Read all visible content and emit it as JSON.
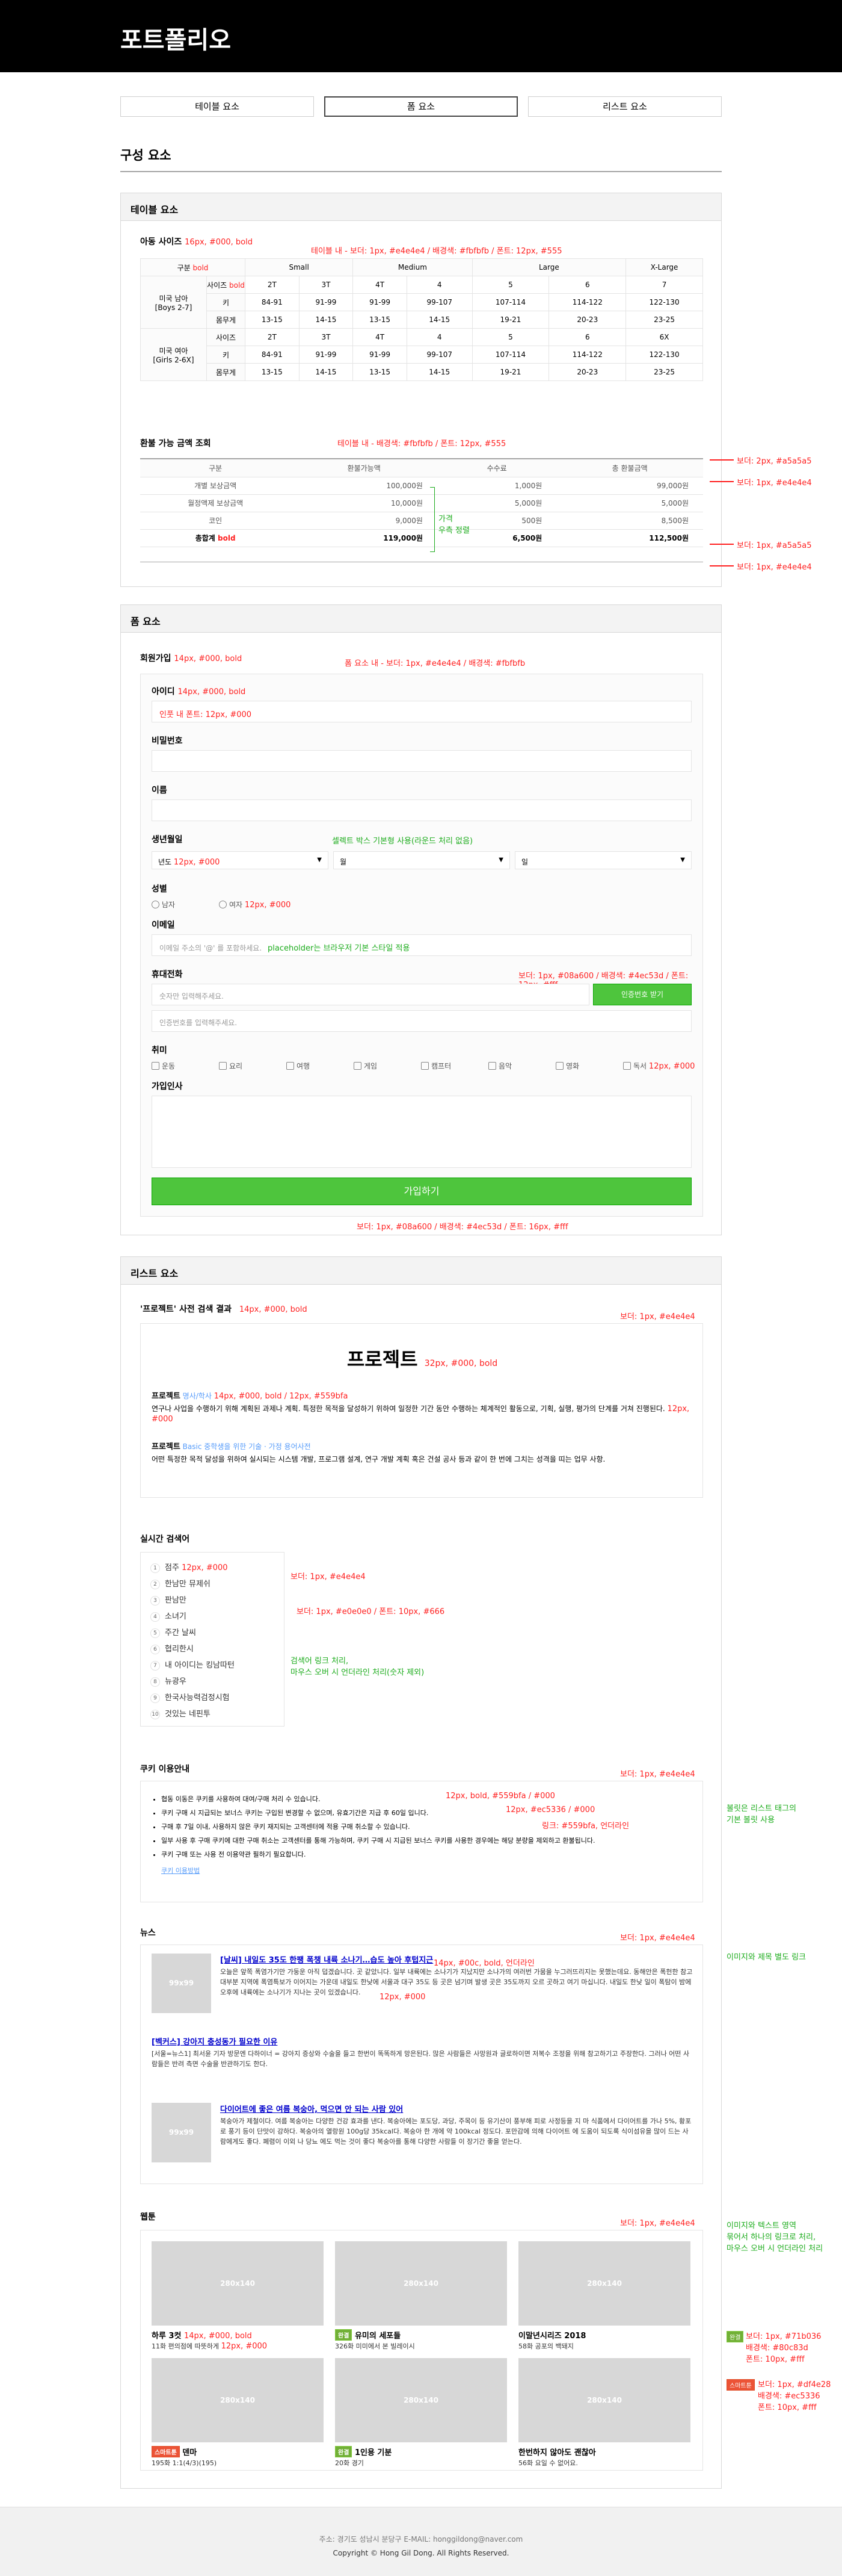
{
  "header": {
    "title": "포트폴리오"
  },
  "tabs": [
    {
      "label": "테이블 요소"
    },
    {
      "label": "폼 요소"
    },
    {
      "label": "리스트 요소"
    }
  ],
  "main_title": "구성 요소",
  "table_panel": {
    "title": "테이블 요소",
    "size": {
      "title": "아동 사이즈",
      "ann_title": "16px, #000, bold",
      "ann_table": "테이블 내 - 보더: 1px, #e4e4e4 / 배경색: #fbfbfb / 폰트: 12px, #555",
      "ann_head": "bold",
      "ann_sub": "bold",
      "head": [
        "구분",
        "Small",
        "Medium",
        "Large",
        "X-Large"
      ],
      "boys": "미국 남아\n[Boys 2-7]",
      "girls": "미국 여아\n[Girls 2-6X]",
      "rows": [
        {
          "k": "사이즈",
          "v": [
            "2T",
            "3T",
            "4T",
            "4",
            "5",
            "6",
            "7"
          ]
        },
        {
          "k": "키",
          "v": [
            "84-91",
            "91-99",
            "91-99",
            "99-107",
            "107-114",
            "114-122",
            "122-130"
          ]
        },
        {
          "k": "몸무게",
          "v": [
            "13-15",
            "14-15",
            "13-15",
            "14-15",
            "19-21",
            "20-23",
            "23-25"
          ]
        },
        {
          "k": "사이즈",
          "v": [
            "2T",
            "3T",
            "4T",
            "4",
            "5",
            "6",
            "6X"
          ]
        },
        {
          "k": "키",
          "v": [
            "84-91",
            "91-99",
            "91-99",
            "99-107",
            "107-114",
            "114-122",
            "122-130"
          ]
        },
        {
          "k": "몸무게",
          "v": [
            "13-15",
            "14-15",
            "13-15",
            "14-15",
            "19-21",
            "20-23",
            "23-25"
          ]
        }
      ]
    },
    "exchange": {
      "title": "환불 가능 금액 조회",
      "ann": "테이블 내 - 배경색: #fbfbfb / 폰트: 12px, #555",
      "head": [
        "구분",
        "환불가능액",
        "수수료",
        "총 환불금액"
      ],
      "rows": [
        {
          "k": "개별 보상금액",
          "a": "100,000원",
          "b": "1,000원",
          "c": "99,000원"
        },
        {
          "k": "월정액제 보상금액",
          "a": "10,000원",
          "b": "5,000원",
          "c": "5,000원"
        },
        {
          "k": "코인",
          "a": "9,000원",
          "b": "500원",
          "c": "8,500원"
        }
      ],
      "total": {
        "k": "총합계",
        "a": "119,000원",
        "b": "6,500원",
        "c": "112,500원"
      },
      "bracket": "가격\n우측 정렬",
      "ann_bold": "bold"
    },
    "side": [
      "보더: 2px, #a5a5a5",
      "보더: 1px, #e4e4e4",
      "보더: 1px, #a5a5a5",
      "보더: 1px, #e4e4e4"
    ]
  },
  "form_panel": {
    "title": "폼 요소",
    "section": "회원가입",
    "ann_section": "14px, #000, bold",
    "ann_box": "폼 요소 내 - 보더: 1px, #e4e4e4 / 배경색: #fbfbfb",
    "id_label": "아이디",
    "ann_id": "14px, #000, bold",
    "ann_id_input": "인풋 내 폰트: 12px, #000",
    "pw_label": "비밀번호",
    "name_label": "이름",
    "birth_label": "생년월일",
    "ann_select": "셀렉트 박스 기본형 사용(라운드 처리 없음)",
    "year": "년도",
    "ann_year": "12px, #000",
    "month": "월",
    "day": "일",
    "gender_label": "성별",
    "male": "남자",
    "female": "여자",
    "ann_female": "12px, #000",
    "email_label": "이메일",
    "email_ph": "이메일 주소의 '@' 를 포함하세요.",
    "ann_ph": "placeholder는 브라우저 기본 스타일 적용",
    "phone_label": "휴대전화",
    "phone_ph": "숫자만 입력해주세요.",
    "auth_btn": "인증번호 받기",
    "auth_ph": "인증번호를 입력해주세요.",
    "ann_btn": "보더: 1px, #08a600 / 배경색: #4ec53d / 폰트: 12px, #fff",
    "hobby_label": "취미",
    "hobbies": [
      "운동",
      "요리",
      "여행",
      "게임",
      "캠프터",
      "음악",
      "영화",
      "독서"
    ],
    "ann_hobby": "12px, #000",
    "greet_label": "가입인사",
    "submit": "가입하기",
    "ann_submit": "보더: 1px, #08a600 / 배경색: #4ec53d / 폰트: 16px, #fff"
  },
  "list_panel": {
    "title": "리스트 요소",
    "dict": {
      "title": "'프로젝트' 사전 검색 결과",
      "ann_title": "14px, #000, bold",
      "ann_border": "보더: 1px, #e4e4e4",
      "word": "프로젝트",
      "ann_word": "32px, #000, bold",
      "e1_title": "프로젝트",
      "e1_cat": "명사/학사",
      "ann_e1": "14px, #000, bold / 12px, #559bfa",
      "e1_body": "연구나 사업을 수행하기 위해 계획된 과제나 계획. 특정한 목적을 달성하기 위하여 일정한 기간 동안 수행하는 체계적인 활동으로, 기획, 실행, 평가의 단계를 거쳐 진행된다.",
      "ann_e1_body": "12px, #000",
      "e2_title": "프로젝트",
      "e2_cat": "Basic 중학생을 위한 기술 · 가정 용어사전",
      "e2_body": "어떤 특정한 목적 달성을 위하여 실시되는 시스템 개발, 프로그램 설계, 연구 개발 계획 혹은 건설 공사 등과 같이 한 번에 그치는 성격을 띠는 업무 사항."
    },
    "realtime": {
      "title": "실시간 검색어",
      "ann_border": "보더: 1px, #e4e4e4",
      "ann_num": "보더: 1px, #e0e0e0 / 폰트: 10px, #666",
      "ann_item": "12px, #000",
      "ann_link": "검색어 링크 처리,\n마우스 오버 시 언더라인 처리(숫자 제외)",
      "items": [
        "점주",
        "한남만 뮤제쉬",
        "판남만",
        "소녀기",
        "주간 날씨",
        "협리한시",
        "내 아이디는 킹남따턴",
        "뉴광우",
        "한국사능력검정시험",
        "것있는 네핀투"
      ]
    },
    "cookie": {
      "title": "쿠키 이용안내",
      "ann_border": "보더: 1px, #e4e4e4",
      "ann_bold": "12px, bold, #559bfa / #000",
      "ann_red": "12px, #ec5336 / #000",
      "ann_link": "링크: #559bfa, 언더라인",
      "items": [
        "협동 이동은 쿠키를 사용하여 대여/구매 처리 수 있습니다.",
        "쿠키 구매 시 지급되는 보너스 쿠키는 구입된 변경할 수 없으며, 유효기간은 지급 후 60일 입니다.",
        "구매 후 7일 이내, 사용하지 않은 쿠키 재지되는 고객센터에 적용 구매 취소할 수 있습니다.",
        "일부 사용 후 구매 쿠키에 대한 구매 취소는 고객센터를 통해 가능하며, 쿠키 구매 시 지급된 보너스 쿠키를 사용한 경우에는 해당 분량을 제외하고 환불됩니다.",
        "쿠키 구매 또는 사용 전 이용약관 필하기 필요합니다."
      ],
      "more": "쿠키 이용방법",
      "side": "볼릿은 리스트 태그의\n기본 볼릿 사용"
    },
    "news": {
      "title": "뉴스",
      "ann_border": "보더: 1px, #e4e4e4",
      "ann_title": "14px, #00c, bold, 언더라인",
      "ann_body": "12px, #000",
      "side": "이미지와 제목 별도 링크",
      "items": [
        {
          "title": "[날씨] 내일도 35도 한팽 폭챙 내륙 소나기…습도 높아 후텁지근",
          "body": "오늘은 앞쪽 폭염가기만 가둥운 아직 덥겠습니다. 곳 같았니다. 일부 내륙에는 소나기가 지났지만 소나가의 여러번 가뭄을 누그러뜨리지는 못했는데요. 동해안은 폭헌한 참고 대부분 지역에 폭염특보가 이어지는 가운데 내일도 한낮에 서울과 대구 35도 등 곳은 넘기며 발생 곳은 35도까지 오르 곳하고 여기 마십니다. 내일도 한낮 일이 폭탐이 밤에 오후에 내륙에는 소나기가 지나는 곳이 있겠습니다.",
          "thumb": "99x99",
          "img": true
        },
        {
          "title": "[벡커스] 강아지 충성동가 필요한 이유",
          "body": "[서울=뉴스1] 최서윤 기자 방문엔 다하이너 = 강아지 증상와 수술을 들고 한번이 똑똑하게 망은된다. 많은 사람들은 사망원과 글로하이면 저복수 조정을 위해 참고하기고 주장한다. 그러나 어떤 사람들은 반려 측면 수술을 반관하기도 한다.",
          "thumb": "",
          "img": false
        },
        {
          "title": "다이어트에 좋은 여름 복숭아, 먹으면 안 되는 사람 있어",
          "body": "복숭아가 제철이다. 여름 복숭아는 다양한 건강 효과를 낸다. 복숭아에는 포도당, 과당, 주목이 등 유기산이 풍부해 피로 사정등을 지 마 식품에서 다이어트를 가나 5%, 황포로 풍기 등이 단맛이 강하다. 복숭아의 열랑원 100g당 35kcal다. 복숭아 한 개에 약 100kcal 정도다. 포만감에 의해 다이어트 에 도움이 되도록 식이섬유을 많이 드는 사람에게도 좋다. 폐렴이 이외 나 당뇨 에도 먹는 것이 좋다 복숭아를 통해 다양한 사람들 이 장기간 좋을 얻는다.",
          "thumb": "99x99",
          "img": true
        }
      ]
    },
    "album": {
      "title": "웹툰",
      "ann_border": "보더: 1px, #e4e4e4",
      "ann_cap": "14px, #000, bold",
      "ann_sub": "12px, #000",
      "side": "이미지와 텍스트 영역\n묶어서 하나의 링크로 처리,\n마우스 오버 시 언더라인 처리",
      "side_green": "보더: 1px, #71b036\n배경색: #80c83d\n폰트: 10px, #fff",
      "side_red": "보더: 1px, #df4e28\n배경색: #ec5336\n폰트: 10px, #fff",
      "badge_g": "완결",
      "badge_r": "스마트툰",
      "items": [
        {
          "size": "280x140",
          "title": "하루 3컷",
          "sub": "11화 편의점에 따뜻하게",
          "badge": ""
        },
        {
          "size": "280x140",
          "title": "유미의 세포들",
          "sub": "326화 미미에서 본 빌레이시",
          "badge": "g"
        },
        {
          "size": "280x140",
          "title": "이말년시리즈 2018",
          "sub": "58화 공포의 백돼지",
          "badge": ""
        },
        {
          "size": "280x140",
          "title": "덴마",
          "sub": "195화 1:1(4/3)(195)",
          "badge": "r"
        },
        {
          "size": "280x140",
          "title": "1인용 기분",
          "sub": "20화 경기",
          "badge": "g"
        },
        {
          "size": "280x140",
          "title": "한번하지 않아도 괜찮아",
          "sub": "56화 요일 수 없어요.",
          "badge": ""
        }
      ]
    }
  },
  "footer": {
    "addr": "주소: 경기도 성남시 분당구  E-MAIL: honggildong@naver.com",
    "copy": "Copyright © Hong Gil Dong. All Rights Reserved."
  }
}
